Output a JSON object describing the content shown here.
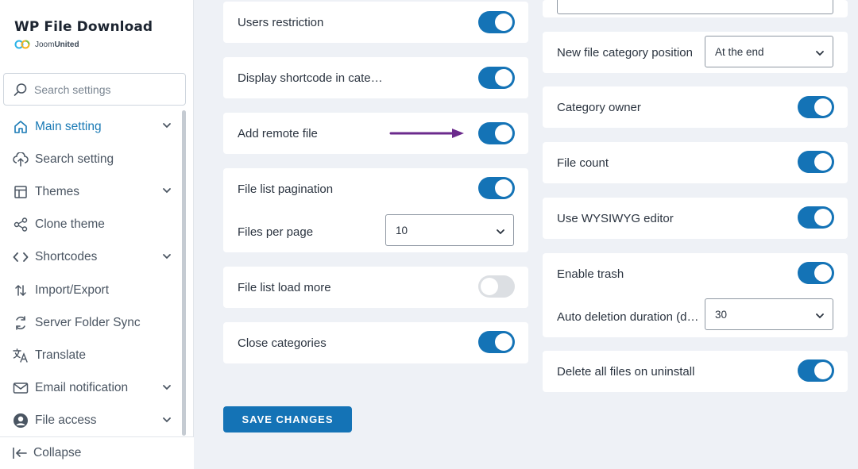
{
  "brand": {
    "title": "WP File Download",
    "sub_part1": "Joom",
    "sub_part2": "United"
  },
  "search": {
    "placeholder": "Search settings"
  },
  "nav": {
    "items": [
      {
        "label": "Main setting",
        "icon": "home-icon",
        "has_children": true,
        "active": true
      },
      {
        "label": "Search setting",
        "icon": "cloud-upload-icon",
        "has_children": false
      },
      {
        "label": "Themes",
        "icon": "layout-icon",
        "has_children": true
      },
      {
        "label": "Clone theme",
        "icon": "share-icon",
        "has_children": false
      },
      {
        "label": "Shortcodes",
        "icon": "code-icon",
        "has_children": true
      },
      {
        "label": "Import/Export",
        "icon": "import-export-icon",
        "has_children": false
      },
      {
        "label": "Server Folder Sync",
        "icon": "sync-icon",
        "has_children": false
      },
      {
        "label": "Translate",
        "icon": "translate-icon",
        "has_children": false
      },
      {
        "label": "Email notification",
        "icon": "mail-icon",
        "has_children": true
      },
      {
        "label": "File access",
        "icon": "user-icon",
        "has_children": true
      }
    ],
    "collapse_label": "Collapse"
  },
  "left": {
    "users_restriction": {
      "label": "Users restriction",
      "on": true
    },
    "display_shortcode": {
      "label": "Display shortcode in cate…",
      "on": true
    },
    "add_remote_file": {
      "label": "Add remote file",
      "on": true
    },
    "file_list_pagination": {
      "label": "File list pagination",
      "on": true
    },
    "files_per_page": {
      "label": "Files per page",
      "value": "10"
    },
    "file_list_load_more": {
      "label": "File list load more",
      "on": false
    },
    "close_categories": {
      "label": "Close categories",
      "on": true
    }
  },
  "right": {
    "new_category_position": {
      "label": "New file category position",
      "value": "At the end"
    },
    "category_owner": {
      "label": "Category owner",
      "on": true
    },
    "file_count": {
      "label": "File count",
      "on": true
    },
    "wysiwyg": {
      "label": "Use WYSIWYG editor",
      "on": true
    },
    "enable_trash": {
      "label": "Enable trash",
      "on": true
    },
    "auto_deletion": {
      "label": "Auto deletion duration (d…",
      "value": "30"
    },
    "delete_on_uninstall": {
      "label": "Delete all files on uninstall",
      "on": true
    }
  },
  "save_button": {
    "label": "SAVE CHANGES"
  },
  "colors": {
    "accent": "#1473b6",
    "active_nav": "#1a7ab5",
    "arrow": "#6b2a8c",
    "background": "#eef1f6"
  }
}
